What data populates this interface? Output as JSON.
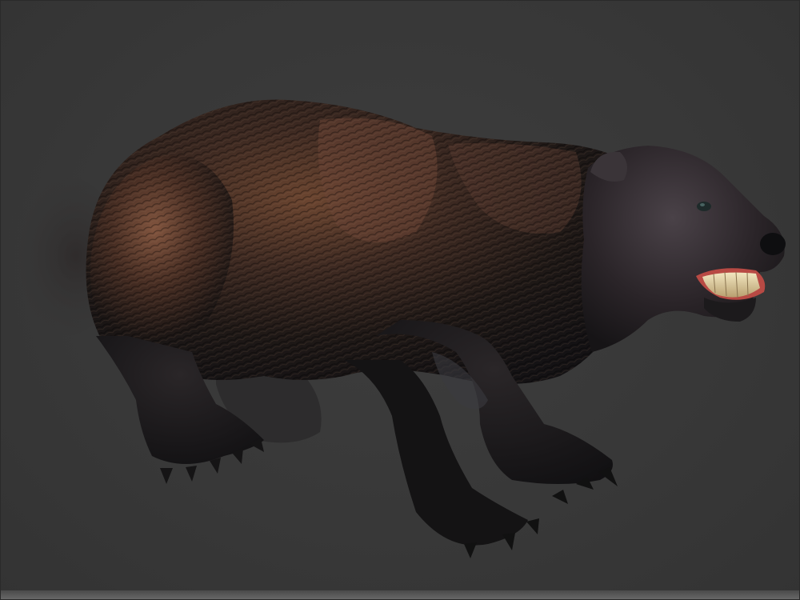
{
  "scene": {
    "subject_icon": "bear-model-icon",
    "background_color": "#383838",
    "fur_dark": "#1a1513",
    "fur_brown": "#5a3a28",
    "fur_highlight": "#7a5240",
    "claw_color": "#1c1c1e",
    "teeth_color": "#e8d8a8",
    "gum_color": "#c0504a"
  }
}
